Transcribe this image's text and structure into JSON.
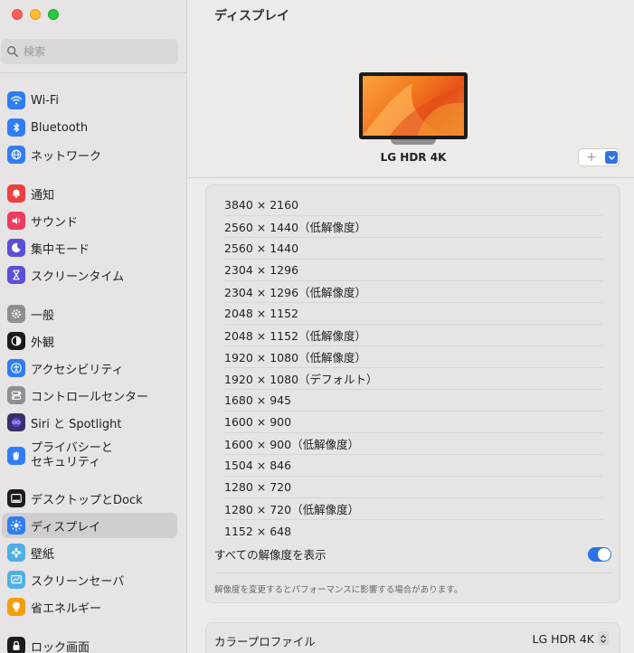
{
  "search": {
    "placeholder": "検索"
  },
  "sidebar": {
    "items": [
      {
        "label": "Wi-Fi",
        "icon": "wifi-icon",
        "color": "#2f7cf6"
      },
      {
        "label": "Bluetooth",
        "icon": "bluetooth-icon",
        "color": "#2f7cf6"
      },
      {
        "label": "ネットワーク",
        "icon": "globe-icon",
        "color": "#2f7cf6"
      },
      {
        "label": "通知",
        "icon": "bell-icon",
        "color": "#ef3e3e"
      },
      {
        "label": "サウンド",
        "icon": "speaker-icon",
        "color": "#ee3c5c"
      },
      {
        "label": "集中モード",
        "icon": "moon-icon",
        "color": "#5b4fd8"
      },
      {
        "label": "スクリーンタイム",
        "icon": "hourglass-icon",
        "color": "#5b4fd8"
      },
      {
        "label": "一般",
        "icon": "gear-icon",
        "color": "#8e8e93"
      },
      {
        "label": "外観",
        "icon": "appearance-icon",
        "color": "#1c1c1e"
      },
      {
        "label": "アクセシビリティ",
        "icon": "accessibility-icon",
        "color": "#2f7cf6"
      },
      {
        "label": "コントロールセンター",
        "icon": "toggles-icon",
        "color": "#8e8e93"
      },
      {
        "label": "Siri と Spotlight",
        "icon": "siri-icon",
        "color": "#3a2f6b"
      },
      {
        "label_line1": "プライバシーと",
        "label_line2": "セキュリティ",
        "icon": "hand-icon",
        "color": "#2f7cf6"
      },
      {
        "label": "デスクトップとDock",
        "icon": "dock-icon",
        "color": "#1c1c1e"
      },
      {
        "label": "ディスプレイ",
        "icon": "sun-icon",
        "color": "#2f7cf6",
        "selected": true
      },
      {
        "label": "壁紙",
        "icon": "flower-icon",
        "color": "#4fb0e6"
      },
      {
        "label": "スクリーンセーバ",
        "icon": "screensaver-icon",
        "color": "#4fb0e6"
      },
      {
        "label": "省エネルギー",
        "icon": "bulb-icon",
        "color": "#f59e0b"
      },
      {
        "label": "ロック画面",
        "icon": "lock-icon",
        "color": "#1c1c1e"
      }
    ]
  },
  "main": {
    "title": "ディスプレイ",
    "monitor_name": "LG HDR 4K",
    "add_button": "+",
    "resolutions": [
      "3840 × 2160",
      "2560 × 1440（低解像度）",
      "2560 × 1440",
      "2304 × 1296",
      "2304 × 1296（低解像度）",
      "2048 × 1152",
      "2048 × 1152（低解像度）",
      "1920 × 1080（低解像度）",
      "1920 × 1080（デフォルト）",
      "1680 × 945",
      "1600 × 900",
      "1600 × 900（低解像度）",
      "1504 × 846",
      "1280 × 720",
      "1280 × 720（低解像度）",
      "1152 × 648"
    ],
    "show_all_label": "すべての解像度を表示",
    "show_all_on": true,
    "note": "解像度を変更するとパフォーマンスに影響する場合があります。",
    "color_profile_label": "カラープロファイル",
    "color_profile_value": "LG HDR 4K"
  },
  "colors": {
    "accent": "#2d73e5",
    "sidebar_bg": "#e6e4e4",
    "main_bg": "#ececec"
  }
}
